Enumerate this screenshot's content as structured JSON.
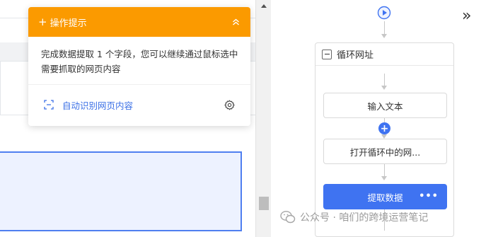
{
  "tip_panel": {
    "title": "操作提示",
    "body": "完成数据提取 1 个字段，您可以继续通过鼠标选中需要抓取的网页内容",
    "auto_detect_label": "自动识别网页内容",
    "header_color": "#fb9a00",
    "link_color": "#3a6fe6"
  },
  "flow": {
    "loop_title": "循环网址",
    "steps": [
      {
        "label": "输入文本"
      },
      {
        "label": "打开循环中的网..."
      },
      {
        "label": "提取数据",
        "active": true,
        "more_label": "•••"
      }
    ],
    "add_step_label": "+",
    "expand_label": "»",
    "accent_color": "#3f73f1"
  },
  "watermark": {
    "text": "公众号 · 咱们的跨境运营笔记"
  },
  "icons": {
    "tip_plus": "plus-icon",
    "collapse": "chevron-up-double-icon",
    "auto_detect": "scan-icon",
    "settings": "gear-icon",
    "start": "play-circle-icon",
    "loop_toggle": "minus-box-icon",
    "expand_panel": "double-chevron-right-icon",
    "watermark_logo": "wechat-logo-icon"
  }
}
